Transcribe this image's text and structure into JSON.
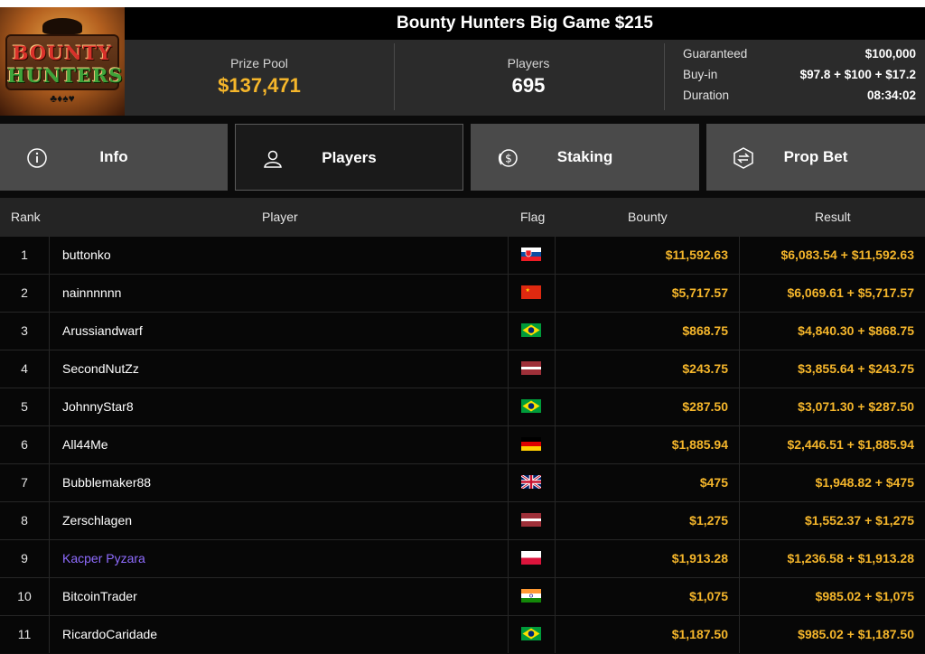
{
  "header": {
    "title": "Bounty Hunters Big Game $215",
    "logo": {
      "line1": "BOUNTY",
      "line2": "HUNTERS",
      "suits": "♣♦♠♥"
    }
  },
  "stats": {
    "prize_pool_label": "Prize Pool",
    "prize_pool_value": "$137,471",
    "players_label": "Players",
    "players_value": "695",
    "details": [
      {
        "label": "Guaranteed",
        "value": "$100,000"
      },
      {
        "label": "Buy-in",
        "value": "$97.8 + $100 + $17.2"
      },
      {
        "label": "Duration",
        "value": "08:34:02"
      }
    ]
  },
  "tabs": [
    {
      "label": "Info",
      "icon": "info-icon",
      "active": false
    },
    {
      "label": "Players",
      "icon": "user-icon",
      "active": true
    },
    {
      "label": "Staking",
      "icon": "dollar-coin-icon",
      "active": false
    },
    {
      "label": "Prop Bet",
      "icon": "prop-bet-icon",
      "active": false
    }
  ],
  "table": {
    "headers": {
      "rank": "Rank",
      "player": "Player",
      "flag": "Flag",
      "bounty": "Bounty",
      "result": "Result"
    },
    "rows": [
      {
        "rank": "1",
        "player": "buttonko",
        "flag": "slovakia-flag-icon",
        "bounty": "$11,592.63",
        "result": "$6,083.54 + $11,592.63"
      },
      {
        "rank": "2",
        "player": "nainnnnnn",
        "flag": "china-flag-icon",
        "bounty": "$5,717.57",
        "result": "$6,069.61 + $5,717.57"
      },
      {
        "rank": "3",
        "player": "Arussiandwarf",
        "flag": "brazil-flag-icon",
        "bounty": "$868.75",
        "result": "$4,840.30 + $868.75"
      },
      {
        "rank": "4",
        "player": "SecondNutZz",
        "flag": "latvia-flag-icon",
        "bounty": "$243.75",
        "result": "$3,855.64 + $243.75"
      },
      {
        "rank": "5",
        "player": "JohnnyStar8",
        "flag": "brazil-flag-icon",
        "bounty": "$287.50",
        "result": "$3,071.30 + $287.50"
      },
      {
        "rank": "6",
        "player": "All44Me",
        "flag": "germany-flag-icon",
        "bounty": "$1,885.94",
        "result": "$2,446.51 + $1,885.94"
      },
      {
        "rank": "7",
        "player": "Bubblemaker88",
        "flag": "uk-flag-icon",
        "bounty": "$475",
        "result": "$1,948.82 + $475"
      },
      {
        "rank": "8",
        "player": "Zerschlagen",
        "flag": "latvia-flag-icon",
        "bounty": "$1,275",
        "result": "$1,552.37 + $1,275"
      },
      {
        "rank": "9",
        "player": "Kacper Pyzara",
        "flag": "poland-flag-icon",
        "bounty": "$1,913.28",
        "result": "$1,236.58 + $1,913.28",
        "highlight": true
      },
      {
        "rank": "10",
        "player": "BitcoinTrader",
        "flag": "india-flag-icon",
        "bounty": "$1,075",
        "result": "$985.02 + $1,075"
      },
      {
        "rank": "11",
        "player": "RicardoCaridade",
        "flag": "brazil-flag-icon",
        "bounty": "$1,187.50",
        "result": "$985.02 + $1,187.50"
      }
    ]
  },
  "colors": {
    "gold": "#f5b62b",
    "link": "#8f6cff",
    "tab": "#4a4a4a",
    "tab_active": "#1a1a1a"
  }
}
